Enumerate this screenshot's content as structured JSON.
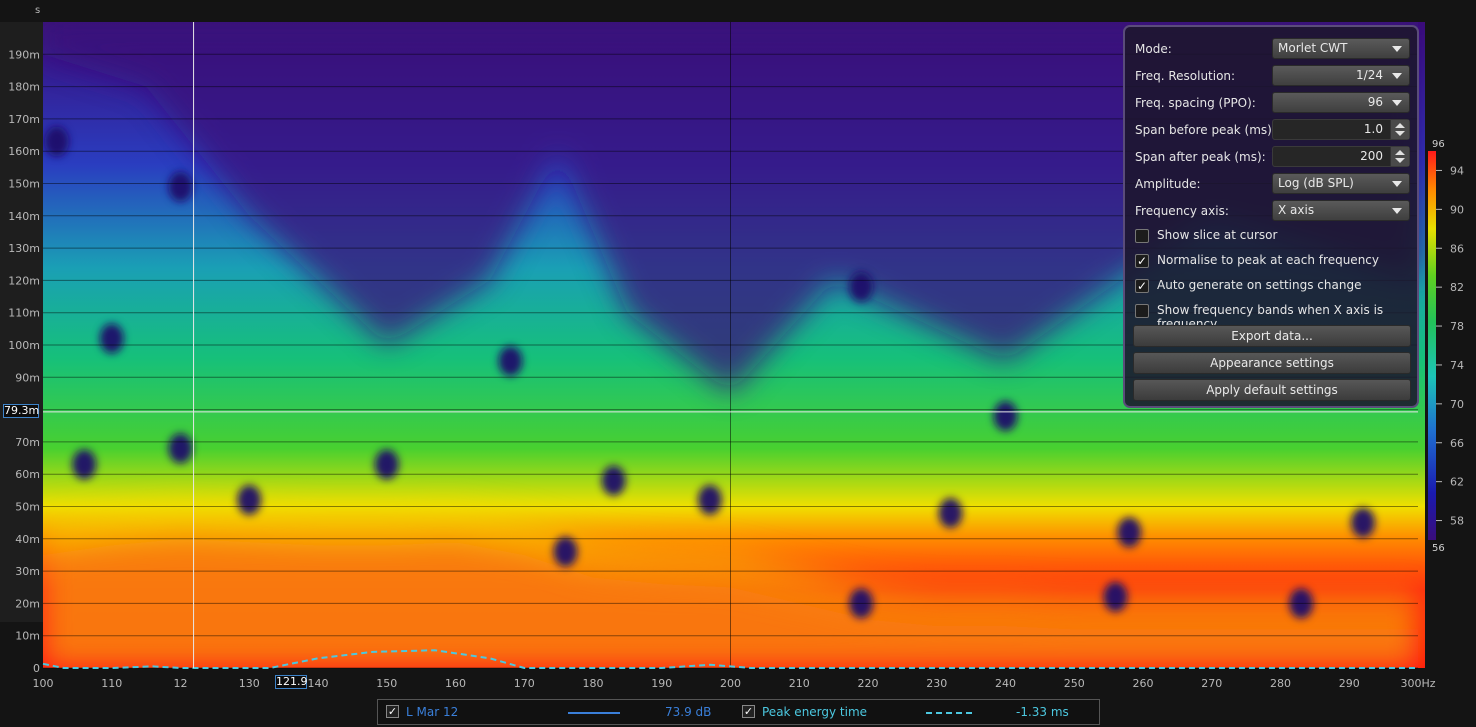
{
  "chart_data": {
    "type": "heatmap",
    "title": "",
    "xlabel": "Hz",
    "ylabel": "s",
    "x_range": [
      100,
      300
    ],
    "y_range": [
      0,
      0.2
    ],
    "x_ticks": [
      "100",
      "110",
      "12",
      "130",
      "140",
      "150",
      "160",
      "170",
      "180",
      "190",
      "200",
      "210",
      "220",
      "230",
      "240",
      "250",
      "260",
      "270",
      "280",
      "290",
      "300Hz"
    ],
    "x_tick_values": [
      100,
      110,
      120,
      130,
      140,
      150,
      160,
      170,
      180,
      190,
      200,
      210,
      220,
      230,
      240,
      250,
      260,
      270,
      280,
      290,
      300
    ],
    "y_ticks": [
      "0",
      "10m",
      "20m",
      "30m",
      "40m",
      "50m",
      "60m",
      "70m",
      "80m",
      "90m",
      "100m",
      "110m",
      "120m",
      "130m",
      "140m",
      "150m",
      "160m",
      "170m",
      "180m",
      "190m"
    ],
    "y_tick_values": [
      0,
      0.01,
      0.02,
      0.03,
      0.04,
      0.05,
      0.06,
      0.07,
      0.08,
      0.09,
      0.1,
      0.11,
      0.12,
      0.13,
      0.14,
      0.15,
      0.16,
      0.17,
      0.18,
      0.19
    ],
    "y_unit": "s",
    "colorbar": {
      "min": 56,
      "max": 96,
      "ticks": [
        58,
        62,
        66,
        70,
        74,
        78,
        82,
        86,
        90,
        94
      ],
      "top_label": "96",
      "bottom_label": "56"
    },
    "cursor": {
      "x": 121.9,
      "y": 0.0793,
      "x_label": "121.9",
      "y_label": "79.3m"
    },
    "contour_boundary_ms": [
      [
        100,
        35
      ],
      [
        110,
        38
      ],
      [
        120,
        40
      ],
      [
        130,
        39
      ],
      [
        140,
        38
      ],
      [
        150,
        38
      ],
      [
        160,
        39
      ],
      [
        170,
        35
      ],
      [
        180,
        28
      ],
      [
        190,
        26
      ],
      [
        200,
        25
      ],
      [
        210,
        20
      ],
      [
        220,
        15
      ],
      [
        230,
        13
      ],
      [
        240,
        13
      ],
      [
        250,
        12
      ],
      [
        260,
        12
      ],
      [
        270,
        12
      ],
      [
        280,
        12
      ],
      [
        290,
        12
      ],
      [
        300,
        12
      ]
    ],
    "peak_energy_time_ms": [
      [
        100,
        1.3
      ],
      [
        103,
        0
      ],
      [
        110,
        0
      ],
      [
        116,
        0.5
      ],
      [
        120,
        0
      ],
      [
        133,
        0
      ],
      [
        140,
        3
      ],
      [
        148,
        5
      ],
      [
        157,
        5.5
      ],
      [
        165,
        3
      ],
      [
        170,
        0
      ],
      [
        190,
        0
      ],
      [
        197,
        1
      ],
      [
        203,
        0
      ],
      [
        300,
        0
      ]
    ],
    "dips": [
      [
        102,
        0.163
      ],
      [
        110,
        0.102
      ],
      [
        106,
        0.063
      ],
      [
        120,
        0.068
      ],
      [
        120,
        0.149
      ],
      [
        130,
        0.052
      ],
      [
        150,
        0.063
      ],
      [
        168,
        0.095
      ],
      [
        176,
        0.036
      ],
      [
        183,
        0.058
      ],
      [
        197,
        0.052
      ],
      [
        219,
        0.118
      ],
      [
        219,
        0.02
      ],
      [
        232,
        0.048
      ],
      [
        240,
        0.078
      ],
      [
        256,
        0.022
      ],
      [
        258,
        0.042
      ],
      [
        283,
        0.02
      ],
      [
        292,
        0.045
      ]
    ],
    "series": [
      {
        "name": "L Mar 12",
        "value_label": "73.9 dB",
        "color": "#3a7fd9",
        "style": "solid"
      },
      {
        "name": "Peak energy time",
        "value_label": "-1.33 ms",
        "color": "#4cc8e0",
        "style": "dashed"
      }
    ],
    "grid": true
  },
  "panel": {
    "mode_label": "Mode:",
    "mode_value": "Morlet CWT",
    "freqres_label": "Freq. Resolution:",
    "freqres_value": "1/24",
    "freqspacing_label": "Freq. spacing (PPO):",
    "freqspacing_value": "96",
    "spanbefore_label": "Span before peak (ms):",
    "spanbefore_value": "1.0",
    "spanafter_label": "Span after peak (ms):",
    "spanafter_value": "200",
    "amplitude_label": "Amplitude:",
    "amplitude_value": "Log (dB SPL)",
    "freqaxis_label": "Frequency axis:",
    "freqaxis_value": "X axis",
    "cb_slice_label": "Show slice at cursor",
    "cb_slice_checked": false,
    "cb_normalise_label": "Normalise to peak at each frequency",
    "cb_normalise_checked": true,
    "cb_auto_label": "Auto generate on settings change",
    "cb_auto_checked": true,
    "cb_bands_label": "Show frequency bands when X axis is frequency",
    "cb_bands_checked": false,
    "export_label": "Export data...",
    "appearance_label": "Appearance settings",
    "defaults_label": "Apply default settings"
  },
  "legend": {
    "series1_checked": true,
    "series2_checked": true
  },
  "colors": {
    "background": "#141414",
    "panel_border": "#5a4c7a",
    "cursor_box": "#3d83c9"
  }
}
